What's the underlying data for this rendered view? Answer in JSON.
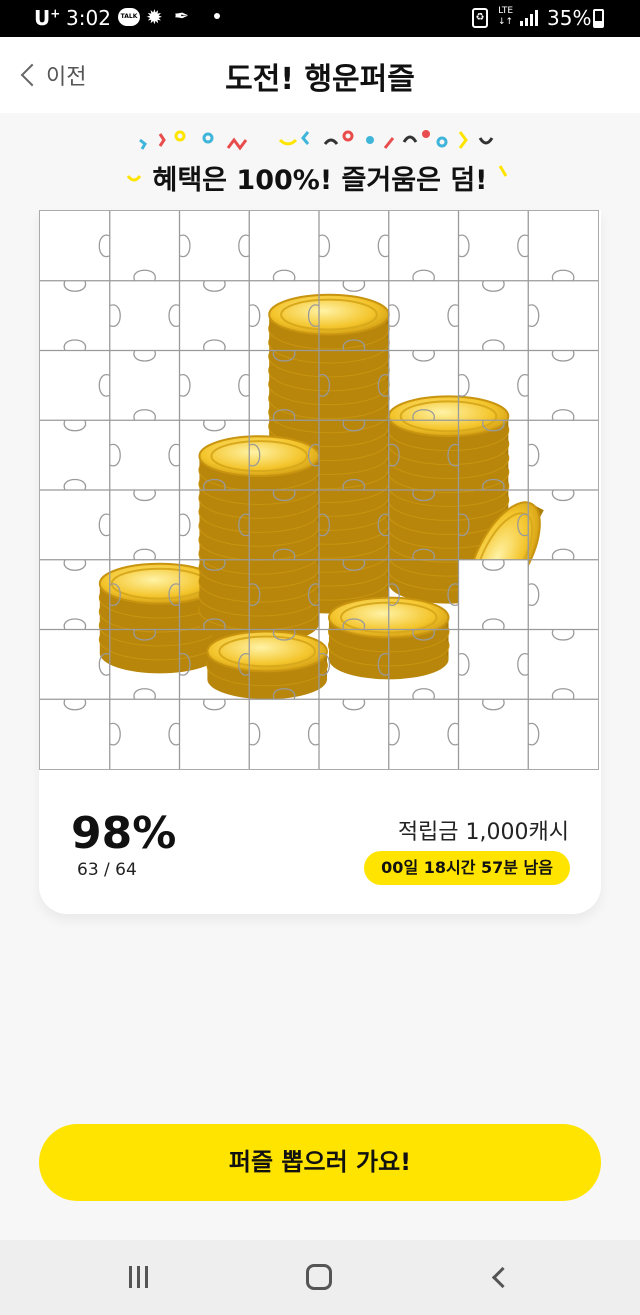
{
  "status_bar": {
    "carrier": "U",
    "carrier_sup": "+",
    "time": "3:02",
    "talk_icon_label": "TALK",
    "network": "LTE",
    "battery": "35%"
  },
  "header": {
    "back_label": "이전",
    "title": "도전! 행운퍼즐"
  },
  "banner": {
    "prefix": "혜택은 ",
    "strong1": "100%!",
    "middle": " 즐거움은 ",
    "strong2": "덤!"
  },
  "puzzle": {
    "grid_cols": 8,
    "grid_rows": 8,
    "image": "gold-coins"
  },
  "progress": {
    "percent": "98%",
    "count": "63 / 64"
  },
  "reward": {
    "label": "적립금 1,000캐시",
    "timer": "00일 18시간 57분 남음"
  },
  "cta": {
    "label": "퍼즐 뽑으러 가요!"
  },
  "nav": {
    "recent_icon": "recent-apps-icon",
    "home_icon": "home-icon",
    "back_icon": "back-icon"
  },
  "colors": {
    "accent": "#ffe400",
    "coin": "#e8b316",
    "text": "#111111"
  }
}
